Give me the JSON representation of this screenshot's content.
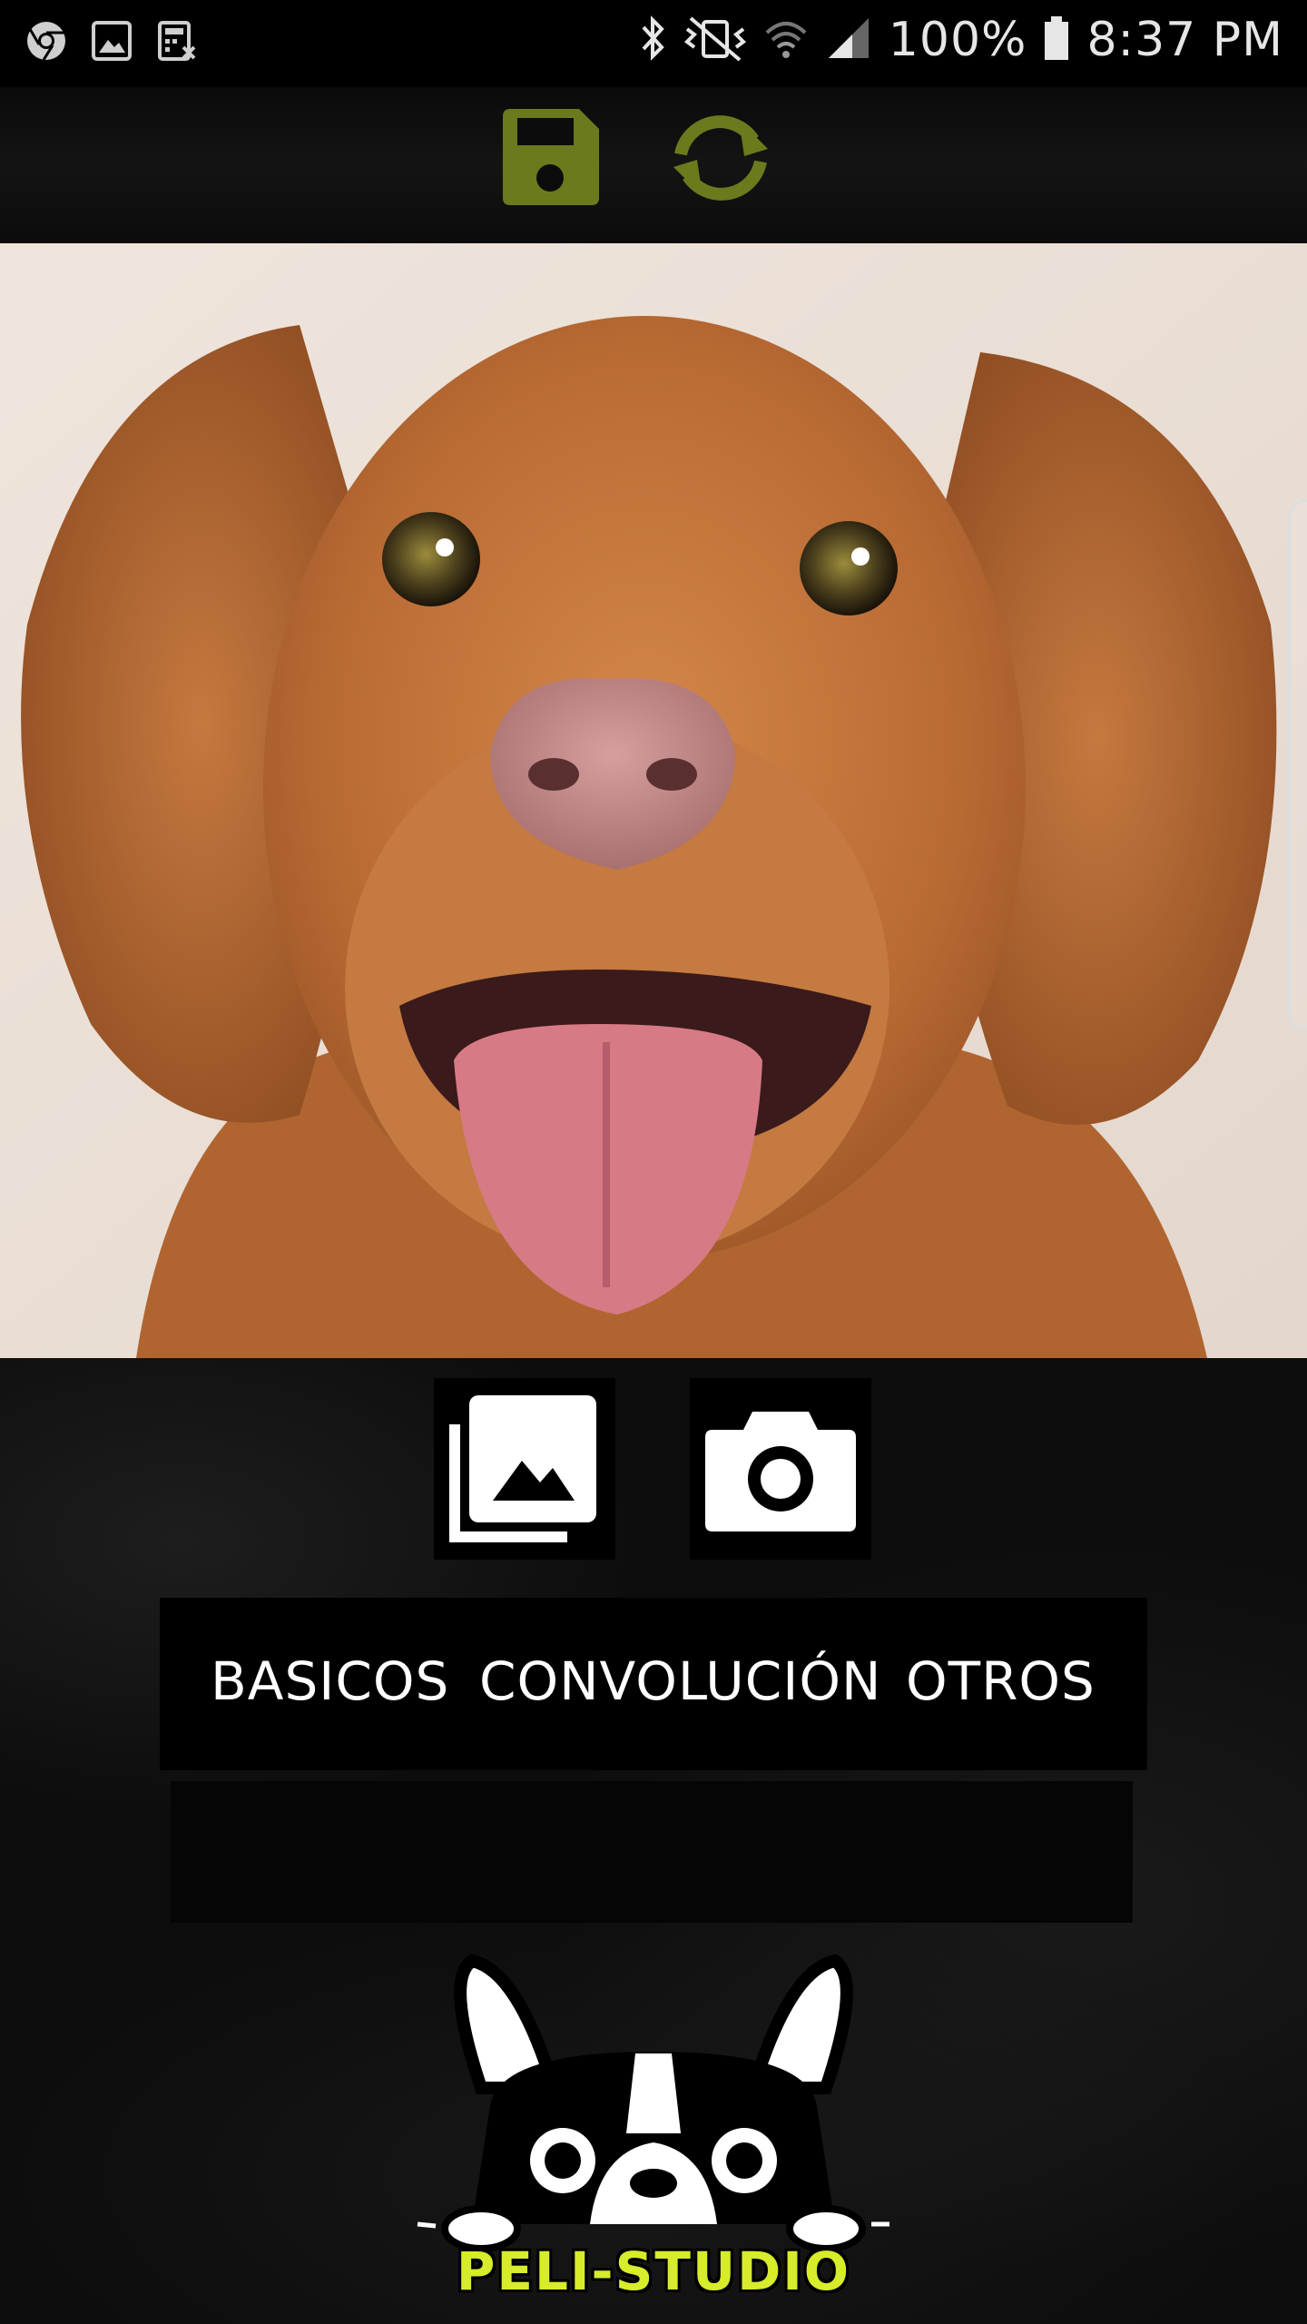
{
  "status_bar": {
    "battery": "100%",
    "time": "8:37 PM",
    "left_icons": [
      "chrome-icon",
      "gallery-icon",
      "calculator-icon"
    ],
    "right_icons": [
      "bluetooth-icon",
      "vibrate-icon",
      "wifi-icon",
      "signal-icon",
      "battery-icon"
    ]
  },
  "toolbar": {
    "icons": [
      "save-icon",
      "refresh-icon"
    ],
    "accent_color": "#6b7a1d"
  },
  "image_sources": {
    "icons": [
      "gallery-icon",
      "camera-icon"
    ]
  },
  "tabs": [
    {
      "label": "BASICOS"
    },
    {
      "label": "CONVOLUCIÓN"
    },
    {
      "label": "OTROS"
    }
  ],
  "logo": {
    "text": "PELI-STUDIO",
    "color": "#d7ec2a"
  }
}
